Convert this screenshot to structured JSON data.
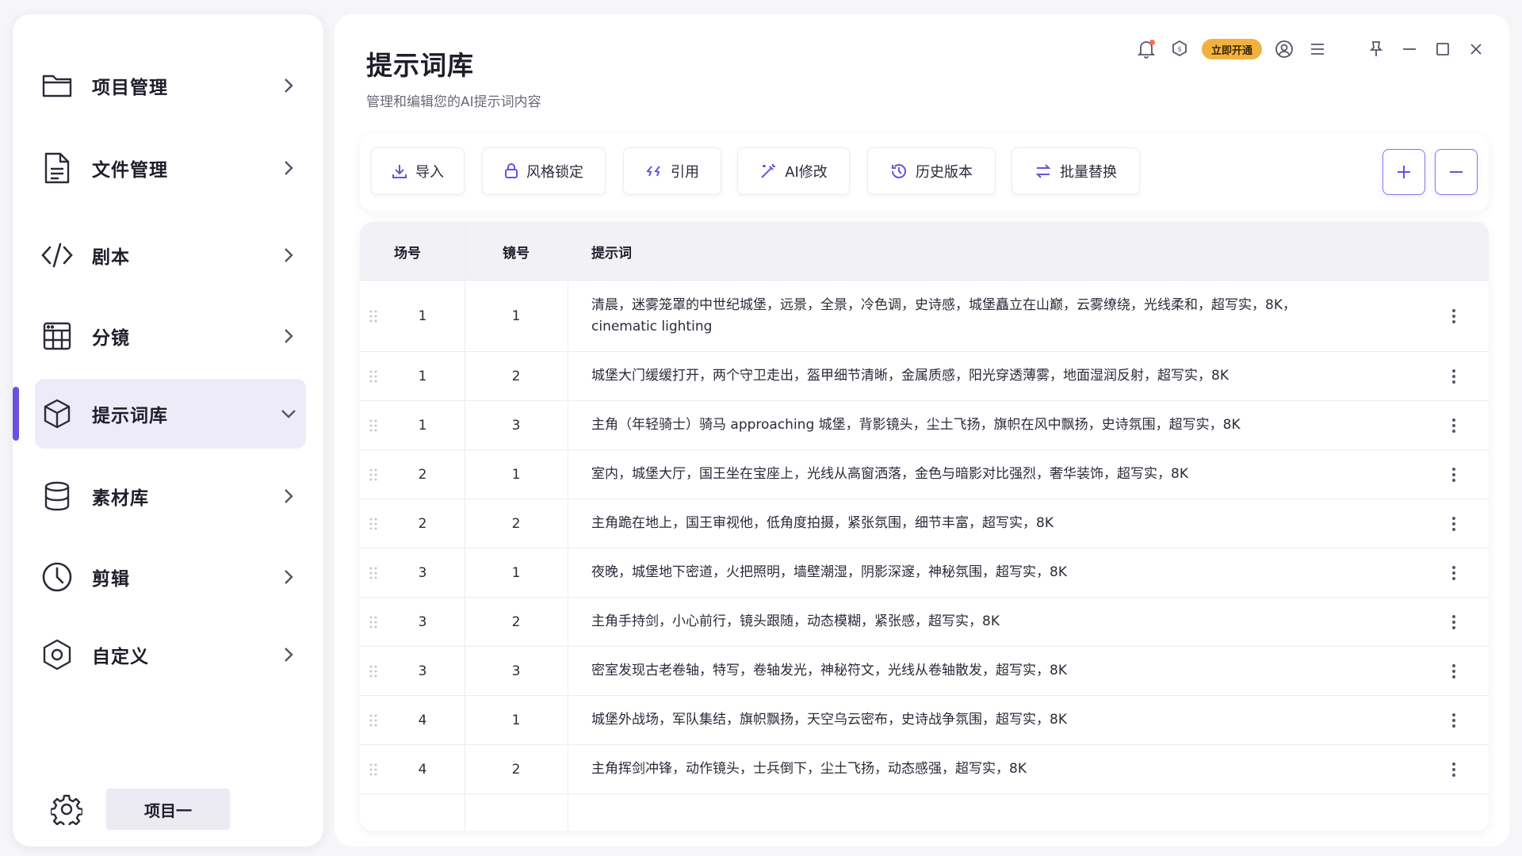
{
  "sidebar": {
    "items": [
      {
        "label": "项目管理",
        "icon": "folder-icon"
      },
      {
        "label": "文件管理",
        "icon": "file-icon"
      },
      {
        "label": "剧本",
        "icon": "code-icon"
      },
      {
        "label": "分镜",
        "icon": "storyboard-grid-icon"
      },
      {
        "label": "提示词库",
        "icon": "cube-icon",
        "active": true
      },
      {
        "label": "素材库",
        "icon": "database-icon"
      },
      {
        "label": "剪辑",
        "icon": "clock-icon"
      },
      {
        "label": "自定义",
        "icon": "hexagon-settings-icon"
      }
    ],
    "project_name": "项目一"
  },
  "header": {
    "title": "提示词库",
    "subtitle": "管理和编辑您的AI提示词内容",
    "vip_label": "立即开通"
  },
  "toolbar": {
    "buttons": [
      {
        "label": "导入",
        "icon": "download-icon"
      },
      {
        "label": "风格锁定",
        "icon": "lock-icon"
      },
      {
        "label": "引用",
        "icon": "quote-icon"
      },
      {
        "label": "AI修改",
        "icon": "magic-wand-icon"
      },
      {
        "label": "历史版本",
        "icon": "history-icon"
      },
      {
        "label": "批量替换",
        "icon": "swap-icon"
      }
    ]
  },
  "table": {
    "columns": [
      "场号",
      "镜号",
      "提示词"
    ],
    "rows": [
      {
        "scene": "1",
        "shot": "1",
        "prompt": "清晨，迷雾笼罩的中世纪城堡，远景，全景，冷色调，史诗感，城堡矗立在山巅，云雾缭绕，光线柔和，超写实，8K，cinematic lighting"
      },
      {
        "scene": "1",
        "shot": "2",
        "prompt": "城堡大门缓缓打开，两个守卫走出，盔甲细节清晰，金属质感，阳光穿透薄雾，地面湿润反射，超写实，8K"
      },
      {
        "scene": "1",
        "shot": "3",
        "prompt": "主角（年轻骑士）骑马 approaching 城堡，背影镜头，尘土飞扬，旗帜在风中飘扬，史诗氛围，超写实，8K"
      },
      {
        "scene": "2",
        "shot": "1",
        "prompt": "室内，城堡大厅，国王坐在宝座上，光线从高窗洒落，金色与暗影对比强烈，奢华装饰，超写实，8K"
      },
      {
        "scene": "2",
        "shot": "2",
        "prompt": "主角跪在地上，国王审视他，低角度拍摄，紧张氛围，细节丰富，超写实，8K"
      },
      {
        "scene": "3",
        "shot": "1",
        "prompt": "夜晚，城堡地下密道，火把照明，墙壁潮湿，阴影深邃，神秘氛围，超写实，8K"
      },
      {
        "scene": "3",
        "shot": "2",
        "prompt": "主角手持剑，小心前行，镜头跟随，动态模糊，紧张感，超写实，8K"
      },
      {
        "scene": "3",
        "shot": "3",
        "prompt": "密室发现古老卷轴，特写，卷轴发光，神秘符文，光线从卷轴散发，超写实，8K"
      },
      {
        "scene": "4",
        "shot": "1",
        "prompt": "城堡外战场，军队集结，旗帜飘扬，天空乌云密布，史诗战争氛围，超写实，8K"
      },
      {
        "scene": "4",
        "shot": "2",
        "prompt": "主角挥剑冲锋，动作镜头，士兵倒下，尘土飞扬，动态感强，超写实，8K"
      }
    ]
  },
  "colors": {
    "accent": "#6d4fe0",
    "vip": "#f2b13e",
    "active_bg": "#ecebf7"
  }
}
